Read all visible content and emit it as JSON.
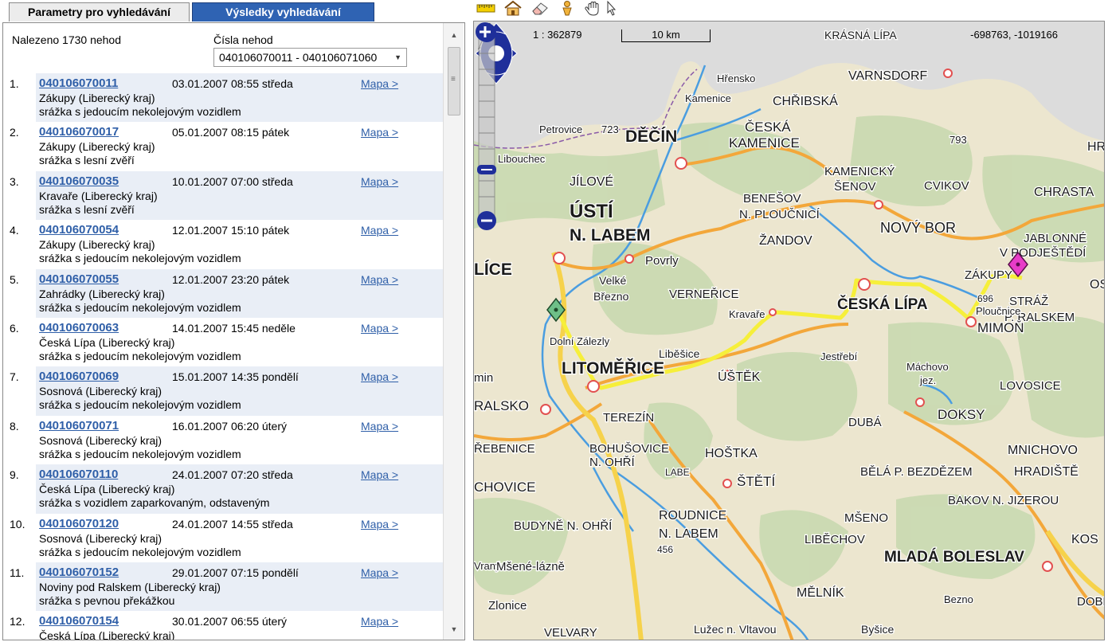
{
  "tabs": {
    "params": "Parametry pro vyhledávání",
    "results": "Výsledky vyhledávání"
  },
  "results": {
    "summary": "Nalezeno 1730 nehod",
    "range_label": "Čísla nehod",
    "range_value": "040106070011 - 040106071060",
    "items": [
      {
        "num": "1.",
        "code": "040106070011",
        "date": "03.01.2007 08:55 středa",
        "map": "Mapa >",
        "loc": "Zákupy (Liberecký kraj)",
        "type": "srážka s jedoucím nekolejovým vozidlem"
      },
      {
        "num": "2.",
        "code": "040106070017",
        "date": "05.01.2007 08:15 pátek",
        "map": "Mapa >",
        "loc": "Zákupy (Liberecký kraj)",
        "type": "srážka s lesní zvěří"
      },
      {
        "num": "3.",
        "code": "040106070035",
        "date": "10.01.2007 07:00 středa",
        "map": "Mapa >",
        "loc": "Kravaře (Liberecký kraj)",
        "type": "srážka s lesní zvěří"
      },
      {
        "num": "4.",
        "code": "040106070054",
        "date": "12.01.2007 15:10 pátek",
        "map": "Mapa >",
        "loc": "Zákupy (Liberecký kraj)",
        "type": "srážka s jedoucím nekolejovým vozidlem"
      },
      {
        "num": "5.",
        "code": "040106070055",
        "date": "12.01.2007 23:20 pátek",
        "map": "Mapa >",
        "loc": "Zahrádky (Liberecký kraj)",
        "type": "srážka s jedoucím nekolejovým vozidlem"
      },
      {
        "num": "6.",
        "code": "040106070063",
        "date": "14.01.2007 15:45 neděle",
        "map": "Mapa >",
        "loc": "Česká Lípa (Liberecký kraj)",
        "type": "srážka s jedoucím nekolejovým vozidlem"
      },
      {
        "num": "7.",
        "code": "040106070069",
        "date": "15.01.2007 14:35 pondělí",
        "map": "Mapa >",
        "loc": "Sosnová (Liberecký kraj)",
        "type": "srážka s jedoucím nekolejovým vozidlem"
      },
      {
        "num": "8.",
        "code": "040106070071",
        "date": "16.01.2007 06:20 úterý",
        "map": "Mapa >",
        "loc": "Sosnová (Liberecký kraj)",
        "type": "srážka s jedoucím nekolejovým vozidlem"
      },
      {
        "num": "9.",
        "code": "040106070110",
        "date": "24.01.2007 07:20 středa",
        "map": "Mapa >",
        "loc": "Česká Lípa (Liberecký kraj)",
        "type": "srážka s vozidlem zaparkovaným, odstaveným"
      },
      {
        "num": "10.",
        "code": "040106070120",
        "date": "24.01.2007 14:55 středa",
        "map": "Mapa >",
        "loc": "Sosnová (Liberecký kraj)",
        "type": "srážka s jedoucím nekolejovým vozidlem"
      },
      {
        "num": "11.",
        "code": "040106070152",
        "date": "29.01.2007 07:15 pondělí",
        "map": "Mapa >",
        "loc": "Noviny pod Ralskem (Liberecký kraj)",
        "type": "srážka s pevnou překážkou"
      },
      {
        "num": "12.",
        "code": "040106070154",
        "date": "30.01.2007 06:55 úterý",
        "map": "Mapa >",
        "loc": "Česká Lípa (Liberecký kraj)",
        "type": ""
      }
    ]
  },
  "toolbar": {
    "tools": [
      "ruler-icon",
      "home-icon",
      "eraser-icon",
      "person-pin-icon",
      "pan-hand-icon",
      "pointer-arrow-icon"
    ]
  },
  "map": {
    "scale_ratio": "1 : 362879",
    "scale_label": "10 km",
    "coords": "-698763, -1019166",
    "north_label": "N",
    "places": [
      "KRÁSNÁ LÍPA",
      "VARNSDORF",
      "Hřensko",
      "CHŘIBSKÁ",
      "ČESKÁ",
      "KAMENICE",
      "Petrovice",
      "723",
      "DĚČÍN",
      "793",
      "Libouchec",
      "JÍLOVÉ",
      "KAMENICKÝ",
      "ŠENOV",
      "CVIKOV",
      "CHRASTA",
      "HRÁ",
      "BENEŠOV",
      "N. PLOUČNICÍ",
      "ÚSTÍ",
      "N. LABEM",
      "ŽANDOV",
      "NOVÝ BOR",
      "JABLONNÉ",
      "V PODJEŠTĚDÍ",
      "LÍCE",
      "Povrly",
      "Velké",
      "Březno",
      "VERNEŘICE",
      "ZÁKUPY",
      "OSE",
      "ČESKÁ LÍPA",
      "696",
      "STRÁŽ",
      "P. RALSKEM",
      "MIMOŇ",
      "Kravaře",
      "Dolní Zálezly",
      "Liběšice",
      "Jestřebí",
      "LITOMĚŘICE",
      "ÚŠTĚK",
      "Máchovo",
      "jez.",
      "min",
      "LOVOSICE",
      "RALSKO",
      "TEREZÍN",
      "DUBÁ",
      "DOKSY",
      "ŘEBENICE",
      "BOHUŠOVICE",
      "N. OHŘÍ",
      "HOŠTKA",
      "MNICHOVO",
      "HRADIŠTĚ",
      "ŠTĚTÍ",
      "BĚLÁ P. BEZDĚZEM",
      "CHOVICE",
      "BAKOV N. JIZEROU",
      "BUDYNĚ N. OHŘÍ",
      "ROUDNICE",
      "N. LABEM",
      "MŠENO",
      "LIBĚCHOV",
      "456",
      "MLADÁ BOLESLAV",
      "KOS",
      "Vraný",
      "Mšené-lázně",
      "MĚLNÍK",
      "Zlonice",
      "Bezno",
      "DOBR",
      "VELVARY",
      "Lužec n. Vltavou",
      "Byšice",
      "Kamenice",
      "Ploučnice",
      "LABE"
    ]
  }
}
